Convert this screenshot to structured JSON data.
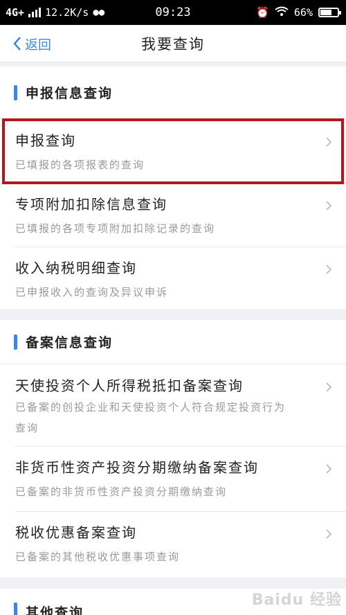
{
  "status_bar": {
    "network": "4G+",
    "speed": "12.2K/s",
    "time": "09:23",
    "battery": "66%",
    "battery_level": 0.66
  },
  "nav": {
    "back_label": "返回",
    "title": "我要查询"
  },
  "sections": [
    {
      "title": "申报信息查询",
      "items": [
        {
          "title": "申报查询",
          "subtitle": "已填报的各项报表的查询"
        },
        {
          "title": "专项附加扣除信息查询",
          "subtitle": "已填报的各项专项附加扣除记录的查询"
        },
        {
          "title": "收入纳税明细查询",
          "subtitle": "已申报收入的查询及异议申诉"
        }
      ]
    },
    {
      "title": "备案信息查询",
      "items": [
        {
          "title": "天使投资个人所得税抵扣备案查询",
          "subtitle": "已备案的创投企业和天使投资个人符合规定投资行为",
          "subtitle2": "查询"
        },
        {
          "title": "非货币性资产投资分期缴纳备案查询",
          "subtitle": "已备案的非货币性资产投资分期缴纳查询"
        },
        {
          "title": "税收优惠备案查询",
          "subtitle": "已备案的其他税收优惠事项查询"
        }
      ]
    },
    {
      "title": "其他查询",
      "items": []
    }
  ],
  "watermark": "Baidu 经验",
  "colors": {
    "accent": "#3a86e6",
    "highlight": "#b3161c",
    "background": "#f0f1f5"
  }
}
